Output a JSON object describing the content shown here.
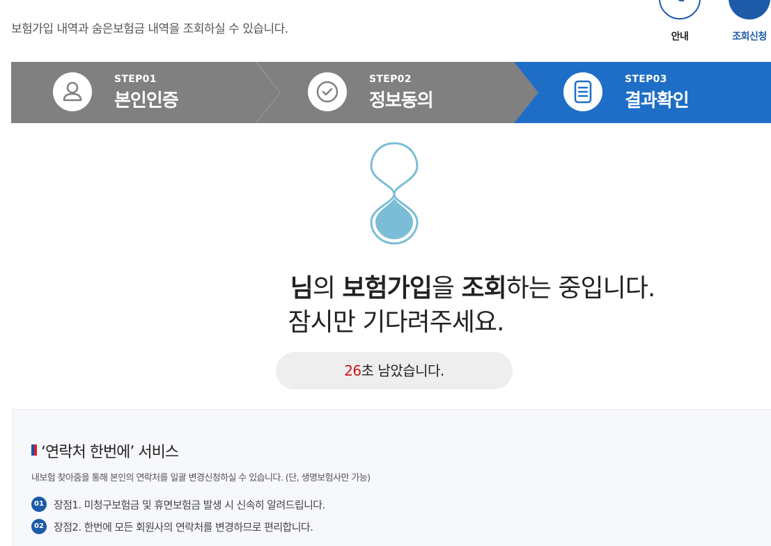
{
  "header": {
    "description": "보험가입 내역과 숨은보험금 내역을 조회하실 수 있습니다.",
    "buttons": [
      {
        "label": "안내",
        "icon": "info-circle-icon"
      },
      {
        "label": "조회신청",
        "icon": "search-apply-icon"
      }
    ]
  },
  "steps": [
    {
      "num": "STEP01",
      "name": "본인인증",
      "icon": "person-icon",
      "active": false
    },
    {
      "num": "STEP02",
      "name": "정보동의",
      "icon": "check-circle-icon",
      "active": false
    },
    {
      "num": "STEP03",
      "name": "결과확인",
      "icon": "document-icon",
      "active": true
    }
  ],
  "message": {
    "name_suffix": "님",
    "of": "의 ",
    "insurance": "보험가입",
    "particle": "을 ",
    "inquiry": "조회",
    "rest": "하는 중입니다.",
    "wait": "잠시만 기다려주세요."
  },
  "countdown": {
    "seconds": "26",
    "suffix": "초 남았습니다."
  },
  "service": {
    "title": "‘연락처 한번에’ 서비스",
    "description": "내보험 찾아줌을 통해 본인의 연락처를 일괄 변경신청하실 수 있습니다. (단, 생명보험사만 가능)",
    "items": [
      {
        "badge": "01",
        "text": "장점1. 미청구보험금 및 휴면보험금 발생 시 신속히 알려드립니다."
      },
      {
        "badge": "02",
        "text": "장점2. 한번에 모든 회원사의 연락처를 변경하므로 편리합니다."
      }
    ]
  },
  "colors": {
    "primary": "#1d5aa8",
    "step_active": "#1e6ec8",
    "step_inactive": "#808080",
    "countdown_highlight": "#d01515",
    "hourglass": "#7bbcd6"
  }
}
